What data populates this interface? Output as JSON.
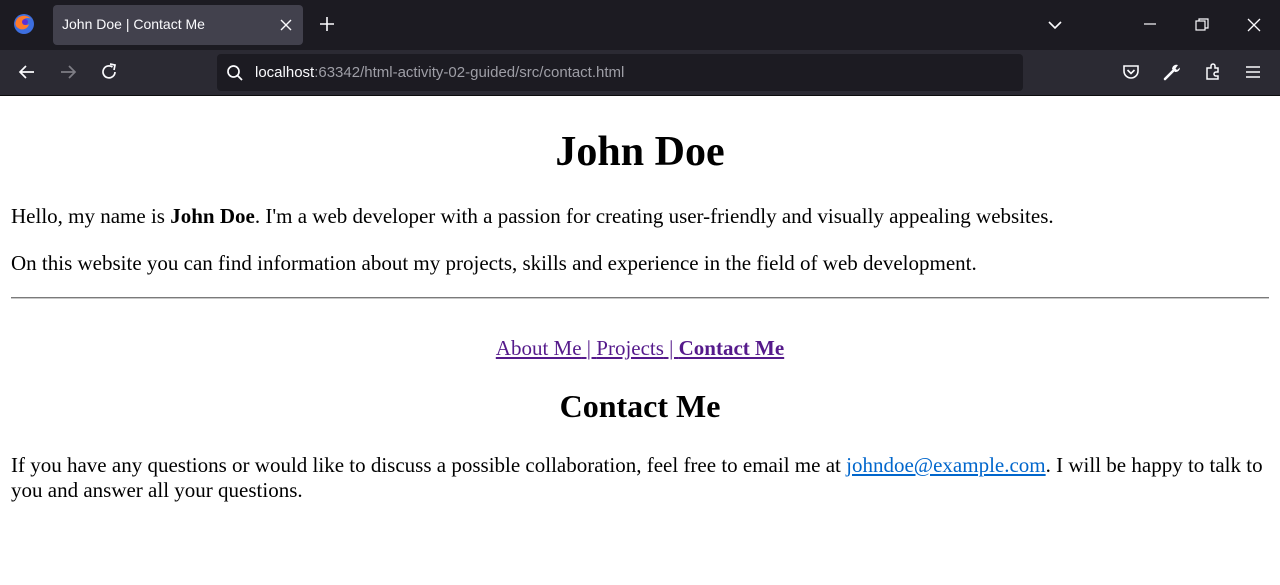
{
  "browser": {
    "tab_title": "John Doe | Contact Me",
    "url_host": "localhost",
    "url_rest": ":63342/html-activity-02-guided/src/contact.html",
    "icons": [
      "firefox-logo",
      "close-icon",
      "plus-icon",
      "chevron-down-icon",
      "minimize-icon",
      "restore-icon",
      "close-icon",
      "back-arrow-icon",
      "forward-arrow-icon",
      "reload-icon",
      "search-icon",
      "pocket-icon",
      "wrench-icon",
      "extensions-icon",
      "hamburger-menu-icon"
    ],
    "colors": {
      "tabbar": "#1c1b22",
      "navbar": "#2b2a33",
      "urlbar": "#1c1b22",
      "active_tab": "#42414d"
    }
  },
  "page": {
    "heading": "John Doe",
    "intro": {
      "before": "Hello, my name is ",
      "name": "John Doe",
      "after": ". I'm a web developer with a passion for creating user-friendly and visually appealing websites."
    },
    "second_paragraph": "On this website you can find information about my projects, skills and experience in the field of web development.",
    "nav": {
      "about": "About Me",
      "separator1": " | ",
      "projects": "Projects",
      "separator2": " | ",
      "contact": "Contact Me"
    },
    "section_title": "Contact Me",
    "contact_text": {
      "before": "If you have any questions or would like to discuss a possible collaboration, feel free to email me at ",
      "email": "johndoe@example.com",
      "after": ". I will be happy to talk to you and answer all your questions."
    },
    "colors": {
      "visited_link": "#551a8b",
      "link": "#0066cc"
    }
  }
}
